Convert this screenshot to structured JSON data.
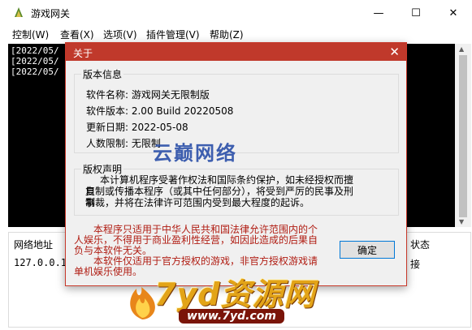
{
  "window": {
    "title": "游戏网关",
    "min_label": "—",
    "max_label": "☐",
    "close_label": "✕"
  },
  "menu": {
    "items": [
      {
        "label": "控制(W)"
      },
      {
        "label": "查看(X)"
      },
      {
        "label": "选项(V)"
      },
      {
        "label": "插件管理(V)"
      },
      {
        "label": "帮助(Z)"
      }
    ]
  },
  "log": {
    "lines": [
      "[2022/05/",
      "[2022/05/",
      "[2022/05/"
    ]
  },
  "list": {
    "headers": {
      "address": "网络地址",
      "status": "状态"
    },
    "row": {
      "address": "127.0.0.1",
      "status": "接"
    }
  },
  "dialog": {
    "title": "关于",
    "close_label": "✕",
    "version_group": "版本信息",
    "info": [
      {
        "text": "软件名称: 游戏网关无限制版"
      },
      {
        "text": "软件版本: 2.00 Build 20220508"
      },
      {
        "text": "更新日期: 2022-05-08"
      },
      {
        "text": "人数限制: 无限制"
      }
    ],
    "copyright_group": "版权声明",
    "copyright_lines": [
      "本计算机程序受著作权法和国际条约保护，如未经授权而擅自",
      "复制或传播本程序（或其中任何部分），将受到严厉的民事及刑事",
      "制裁，并将在法律许可范围内受到最大程度的起诉。"
    ],
    "notice_lines": [
      "本程序只适用于中华人民共和国法律允许范围内的个",
      "人娱乐，不得用于商业盈利性经营，如因此造成的后果自",
      "负与本软件无关。",
      "本软件仅适用于官方授权的游戏，非官方授权游戏请",
      "单机娱乐使用。"
    ],
    "ok_label": "确定"
  },
  "watermark": {
    "top_text": "云巅网络",
    "main_text": "7yd资源网",
    "url_text": "www.7yd.com"
  },
  "colors": {
    "dialog_title_bg": "#c0392b",
    "notice_text": "#b01c12",
    "log_bg": "#000000"
  }
}
